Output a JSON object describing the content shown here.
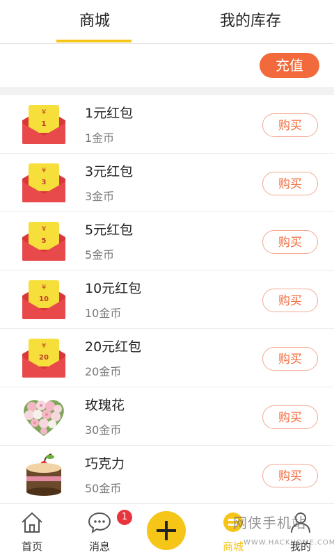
{
  "tabs": [
    {
      "label": "商城",
      "active": true
    },
    {
      "label": "我的库存",
      "active": false
    }
  ],
  "colors": {
    "accent": "#f5c518",
    "brand_orange": "#f26a3b",
    "badge_red": "#e8343d"
  },
  "recharge": {
    "label": "充值"
  },
  "items": [
    {
      "name": "1元红包",
      "price": "1金币",
      "icon": "red-envelope-icon",
      "icon_text": "1",
      "buy_label": "购买"
    },
    {
      "name": "3元红包",
      "price": "3金币",
      "icon": "red-envelope-icon",
      "icon_text": "3",
      "buy_label": "购买"
    },
    {
      "name": "5元红包",
      "price": "5金币",
      "icon": "red-envelope-icon",
      "icon_text": "5",
      "buy_label": "购买"
    },
    {
      "name": "10元红包",
      "price": "10金币",
      "icon": "red-envelope-icon",
      "icon_text": "10",
      "buy_label": "购买"
    },
    {
      "name": "20元红包",
      "price": "20金币",
      "icon": "red-envelope-icon",
      "icon_text": "20",
      "buy_label": "购买"
    },
    {
      "name": "玫瑰花",
      "price": "30金币",
      "icon": "rose-bouquet-icon",
      "buy_label": "购买"
    },
    {
      "name": "巧克力",
      "price": "50金币",
      "icon": "chocolate-cake-icon",
      "buy_label": "购买"
    }
  ],
  "nav": {
    "home": {
      "label": "首页",
      "icon": "home-icon"
    },
    "messages": {
      "label": "消息",
      "icon": "chat-bubble-icon",
      "badge": "1"
    },
    "add": {
      "icon": "plus-icon"
    },
    "shop": {
      "label": "商城",
      "icon": "shop-icon",
      "active": true
    },
    "mine": {
      "label": "我的",
      "icon": "user-icon"
    }
  },
  "watermark": {
    "text": "网侠手机站",
    "url": "WWW.HACKHOME.COM"
  }
}
